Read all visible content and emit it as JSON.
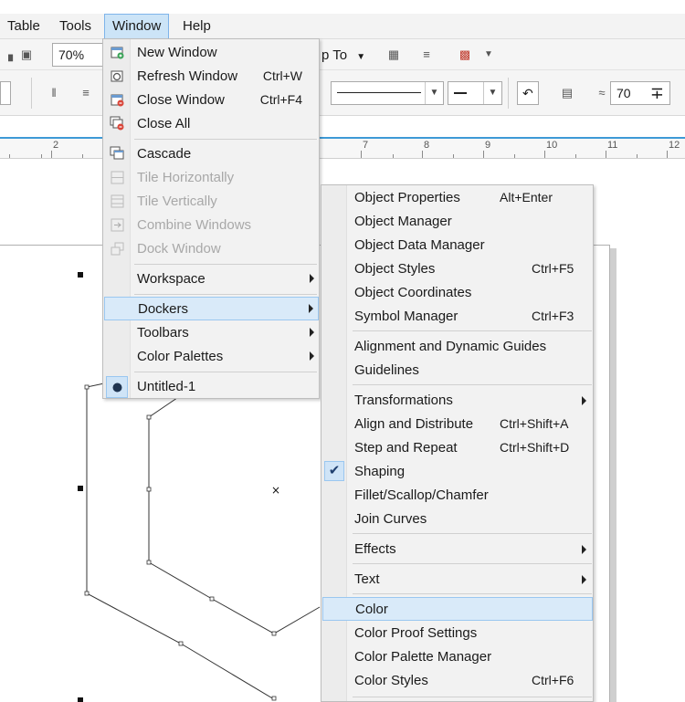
{
  "menubar": {
    "items": [
      "Table",
      "Tools",
      "Window",
      "Help"
    ],
    "active": "Window"
  },
  "toolbar": {
    "zoom_value": "70%",
    "snap_to_label": "p To",
    "smoothing_value": "70"
  },
  "ruler": {
    "labels": [
      "2",
      "7",
      "8",
      "9",
      "10",
      "11",
      "12"
    ]
  },
  "window_menu": {
    "items": [
      {
        "label": "New Window",
        "shortcut": "",
        "icon": "new-window-icon"
      },
      {
        "label": "Refresh Window",
        "shortcut": "Ctrl+W",
        "icon": "refresh-window-icon"
      },
      {
        "label": "Close Window",
        "shortcut": "Ctrl+F4",
        "icon": "close-window-icon"
      },
      {
        "label": "Close All",
        "shortcut": "",
        "icon": "close-all-icon"
      },
      {
        "label": "Cascade",
        "shortcut": "",
        "icon": "cascade-icon"
      },
      {
        "label": "Tile Horizontally",
        "shortcut": "",
        "icon": "tile-horizontally-icon"
      },
      {
        "label": "Tile Vertically",
        "shortcut": "",
        "icon": "tile-vertically-icon"
      },
      {
        "label": "Combine Windows",
        "shortcut": "",
        "icon": "combine-windows-icon"
      },
      {
        "label": "Dock Window",
        "shortcut": "",
        "icon": "dock-window-icon"
      },
      {
        "label": "Workspace",
        "shortcut": "",
        "icon": ""
      },
      {
        "label": "Dockers",
        "shortcut": "",
        "icon": ""
      },
      {
        "label": "Toolbars",
        "shortcut": "",
        "icon": ""
      },
      {
        "label": "Color Palettes",
        "shortcut": "",
        "icon": ""
      },
      {
        "label": "Untitled-1",
        "shortcut": "",
        "icon": "document-bullet-icon"
      }
    ]
  },
  "dockers_menu": {
    "items": [
      {
        "label": "Object Properties",
        "shortcut": "Alt+Enter"
      },
      {
        "label": "Object Manager",
        "shortcut": ""
      },
      {
        "label": "Object Data Manager",
        "shortcut": ""
      },
      {
        "label": "Object Styles",
        "shortcut": "Ctrl+F5"
      },
      {
        "label": "Object Coordinates",
        "shortcut": ""
      },
      {
        "label": "Symbol Manager",
        "shortcut": "Ctrl+F3"
      },
      {
        "label": "Alignment and Dynamic Guides",
        "shortcut": ""
      },
      {
        "label": "Guidelines",
        "shortcut": ""
      },
      {
        "label": "Transformations",
        "shortcut": ""
      },
      {
        "label": "Align and Distribute",
        "shortcut": "Ctrl+Shift+A"
      },
      {
        "label": "Step and Repeat",
        "shortcut": "Ctrl+Shift+D"
      },
      {
        "label": "Shaping",
        "shortcut": ""
      },
      {
        "label": "Fillet/Scallop/Chamfer",
        "shortcut": ""
      },
      {
        "label": "Join Curves",
        "shortcut": ""
      },
      {
        "label": "Effects",
        "shortcut": ""
      },
      {
        "label": "Text",
        "shortcut": ""
      },
      {
        "label": "Color",
        "shortcut": ""
      },
      {
        "label": "Color Proof Settings",
        "shortcut": ""
      },
      {
        "label": "Color Palette Manager",
        "shortcut": ""
      },
      {
        "label": "Color Styles",
        "shortcut": "Ctrl+F6"
      }
    ]
  },
  "colors": {
    "highlight": "#d9eaf9",
    "highlight_border": "#9ac7f0",
    "accent_line": "#3d9ad6"
  }
}
